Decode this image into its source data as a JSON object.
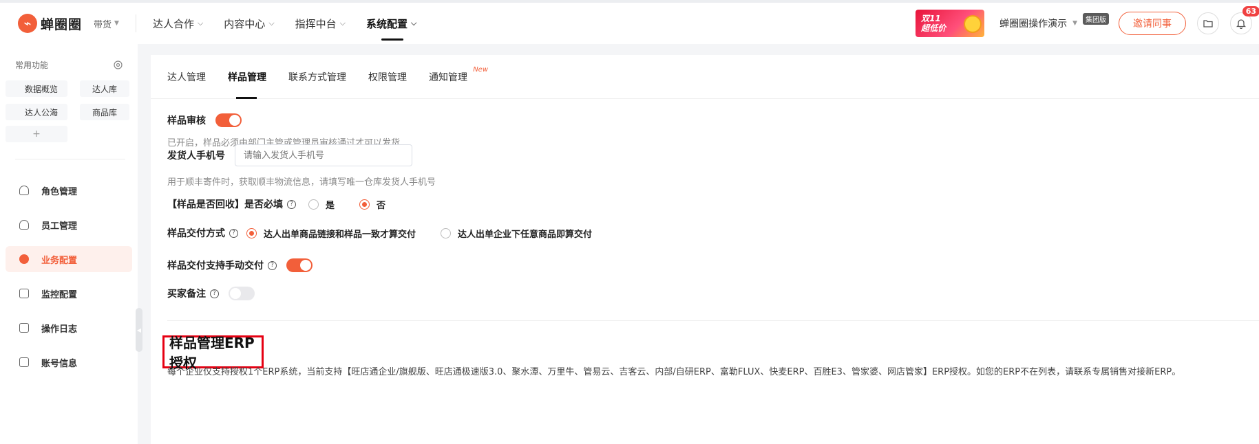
{
  "header": {
    "logo_mark": "⌁",
    "logo_text": "蝉圈圈",
    "scope_label": "带货",
    "nav": [
      {
        "label": "达人合作"
      },
      {
        "label": "内容中心"
      },
      {
        "label": "指挥中台"
      },
      {
        "label": "系统配置",
        "active": true
      }
    ],
    "promo_line1": "双11",
    "promo_line2": "超低价",
    "account_name": "蝉圈圈操作演示",
    "account_tier": "集团版",
    "invite_label": "邀请同事",
    "notification_count": "63"
  },
  "sidebar": {
    "favorites_title": "常用功能",
    "favorites": [
      "数据概览",
      "达人库",
      "达人公海",
      "商品库"
    ],
    "add_label": "+",
    "menu": [
      {
        "label": "角色管理",
        "icon": "user-icon"
      },
      {
        "label": "员工管理",
        "icon": "users-icon"
      },
      {
        "label": "业务配置",
        "icon": "settings-icon",
        "active": true
      },
      {
        "label": "监控配置",
        "icon": "monitor-icon"
      },
      {
        "label": "操作日志",
        "icon": "edit-log-icon"
      },
      {
        "label": "账号信息",
        "icon": "account-icon"
      }
    ]
  },
  "tabs": [
    {
      "label": "达人管理"
    },
    {
      "label": "样品管理",
      "active": true
    },
    {
      "label": "联系方式管理"
    },
    {
      "label": "权限管理"
    },
    {
      "label": "通知管理",
      "tag": "New"
    }
  ],
  "form": {
    "sample_review": {
      "label": "样品审核",
      "enabled": true,
      "hint": "已开启，样品必须由部门主管或管理员审核通过才可以发货"
    },
    "shipper_phone": {
      "label": "发货人手机号",
      "placeholder": "请输入发货人手机号",
      "hint": "用于顺丰寄件时，获取顺丰物流信息，请填写唯一仓库发货人手机号"
    },
    "recycle_required": {
      "label": "【样品是否回收】是否必填",
      "options": [
        "是",
        "否"
      ],
      "selected": "否"
    },
    "delivery_method": {
      "label": "样品交付方式",
      "options": [
        "达人出单商品链接和样品一致才算交付",
        "达人出单企业下任意商品即算交付"
      ],
      "selected": "达人出单商品链接和样品一致才算交付"
    },
    "manual_delivery": {
      "label": "样品交付支持手动交付",
      "enabled": true
    },
    "buyer_note": {
      "label": "买家备注",
      "enabled": false
    }
  },
  "erp": {
    "title": "样品管理ERP授权",
    "description": "每个企业仅支持授权1个ERP系统，当前支持【旺店通企业/旗舰版、旺店通极速版3.0、聚水潭、万里牛、管易云、吉客云、内部/自研ERP、富勒FLUX、快麦ERP、百胜E3、管家婆、网店管家】ERP授权。如您的ERP不在列表，请联系专属销售对接新ERP。"
  },
  "colors": {
    "accent": "#f25f3a",
    "highlight_box": "#e60012"
  }
}
